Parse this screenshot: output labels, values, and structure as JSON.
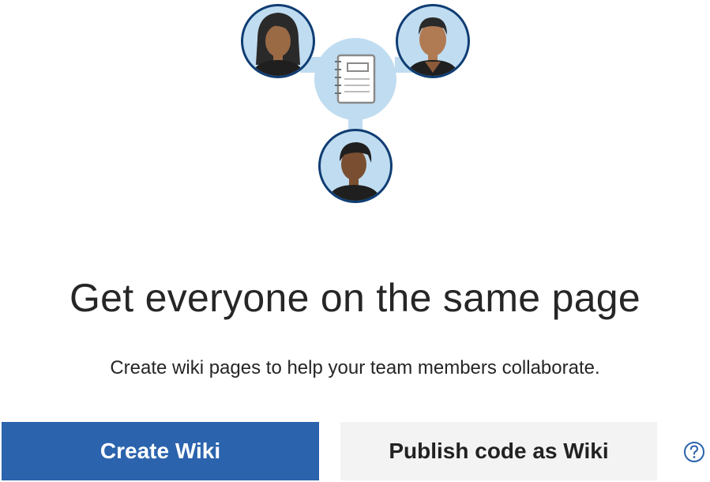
{
  "empty_state": {
    "title": "Get everyone on the same page",
    "description": "Create wiki pages to help your team members collaborate."
  },
  "actions": {
    "create_label": "Create Wiki",
    "publish_label": "Publish code as Wiki",
    "help_icon": "question-circle-icon"
  },
  "illustration": {
    "icons": [
      "woman-avatar-icon",
      "man-avatar-icon",
      "notebook-icon",
      "person-avatar-icon"
    ]
  },
  "colors": {
    "primary": "#2b63ad",
    "secondary": "#f3f3f3",
    "circle_fill": "#c0dcf0",
    "circle_stroke": "#0f3d73"
  }
}
